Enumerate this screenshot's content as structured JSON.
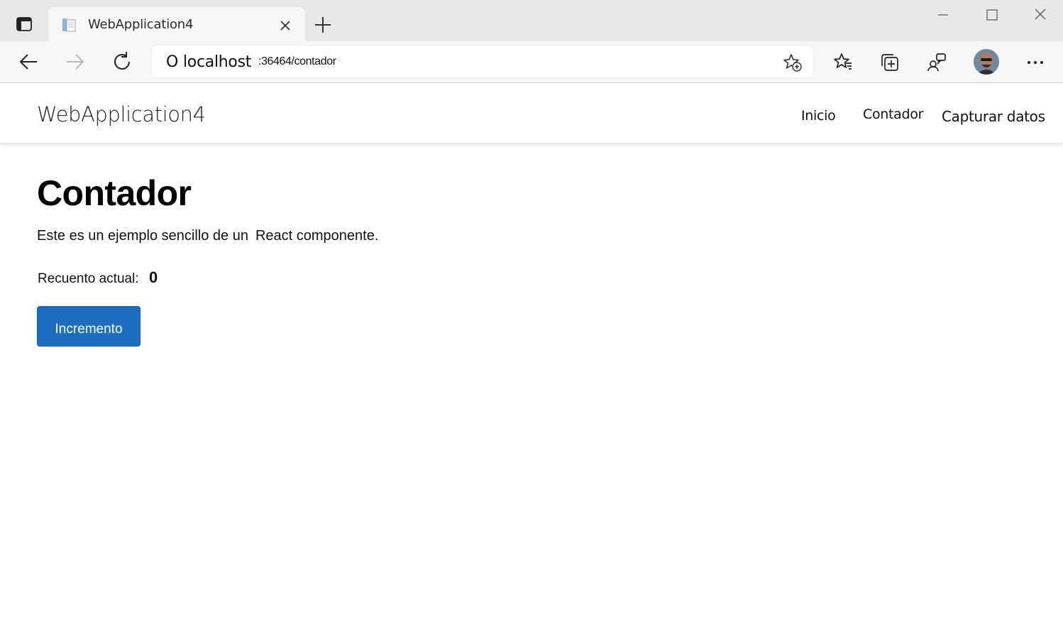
{
  "browser": {
    "tab": {
      "title": "WebApplication4",
      "favicon": "page-icon",
      "close_icon": "close-icon"
    },
    "new_tab_icon": "plus-icon",
    "tab_actions_icon": "tab-actions-icon",
    "window_controls": [
      "minimize-icon",
      "maximize-icon",
      "close-icon"
    ],
    "toolbar": {
      "back_icon": "arrow-left-icon",
      "forward_icon": "arrow-right-icon",
      "reload_icon": "refresh-icon",
      "address": {
        "prefix": "O",
        "host": "localhost",
        "path": ":36464/contador"
      },
      "add_favorite_icon": "star-plus-icon",
      "favorites_icon": "favorites-icon",
      "collections_icon": "collections-icon",
      "feedback_icon": "feedback-icon",
      "profile_icon": "avatar",
      "more_icon": "more-icon"
    }
  },
  "app": {
    "brand": "WebApplication4",
    "nav": {
      "inicio": "Inicio",
      "contador": "Contador",
      "capturar": "Capturar datos"
    }
  },
  "page": {
    "title": "Contador",
    "intro_part1": "Este es un ejemplo sencillo de un",
    "intro_part2": "React componente.",
    "count_label": "Recuento actual:",
    "count_value": "0",
    "button_label": "Incremento"
  },
  "colors": {
    "primary_button": "#1b6ec2",
    "tabstrip": "#e8e8e8",
    "toolbar": "#f7f7f7"
  }
}
